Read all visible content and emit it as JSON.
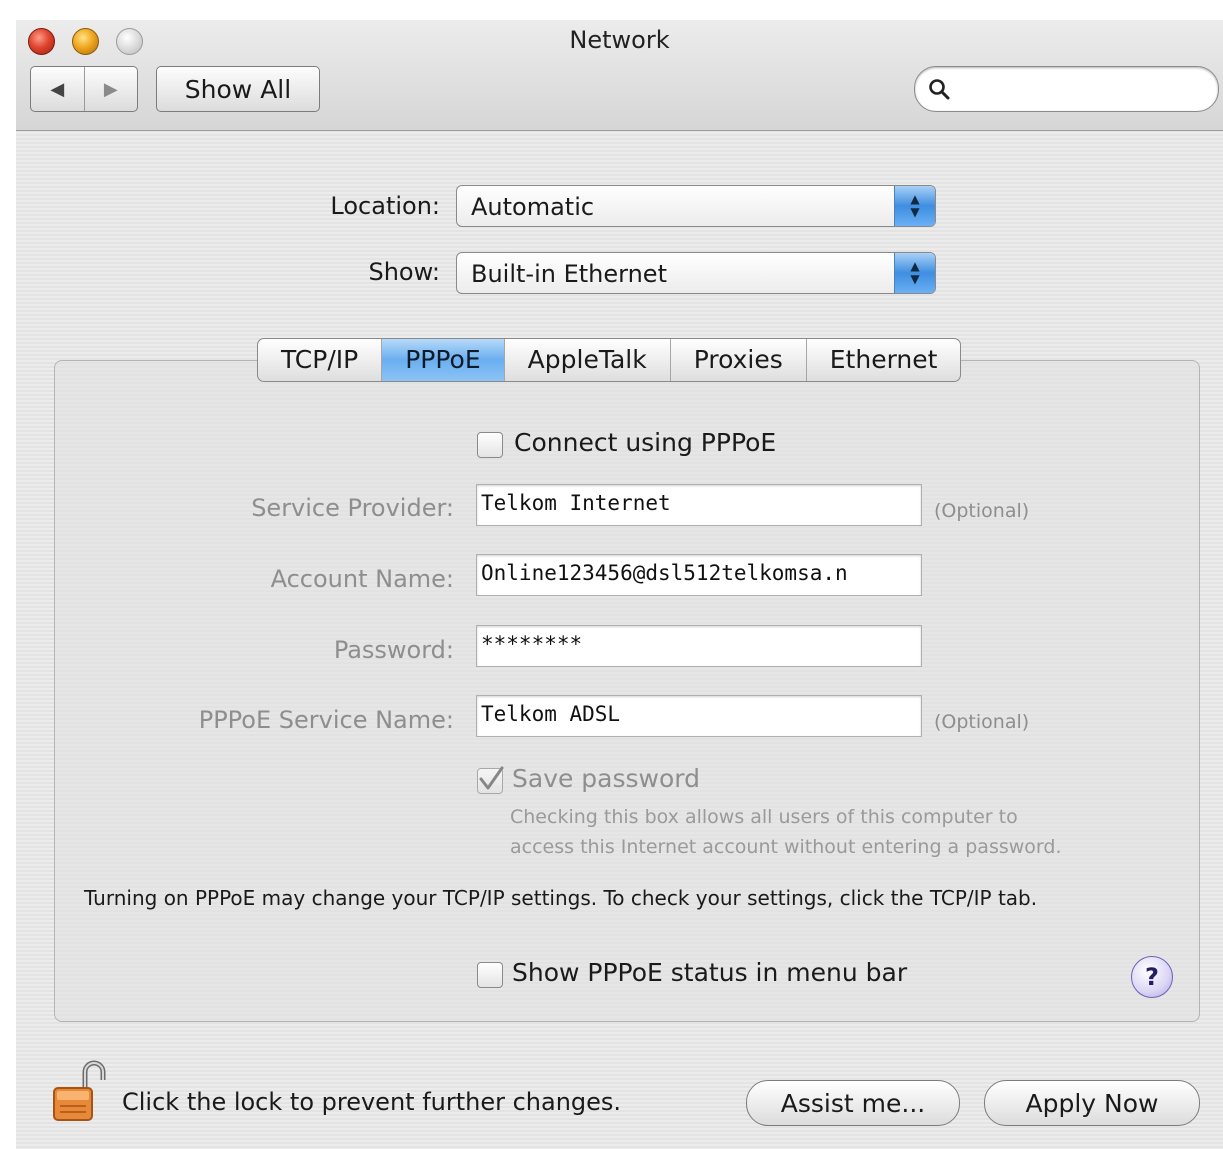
{
  "window": {
    "title": "Network"
  },
  "toolbar": {
    "back_glyph": "◀",
    "forward_glyph": "▶",
    "show_all_label": "Show All",
    "search_value": ""
  },
  "location": {
    "label": "Location:",
    "value": "Automatic"
  },
  "show": {
    "label": "Show:",
    "value": "Built-in Ethernet"
  },
  "tabs": [
    {
      "label": "TCP/IP",
      "selected": false
    },
    {
      "label": "PPPoE",
      "selected": true
    },
    {
      "label": "AppleTalk",
      "selected": false
    },
    {
      "label": "Proxies",
      "selected": false
    },
    {
      "label": "Ethernet",
      "selected": false
    }
  ],
  "pppoe": {
    "connect_label": "Connect using PPPoE",
    "connect_checked": false,
    "service_provider": {
      "label": "Service Provider:",
      "value": "Telkom Internet",
      "note": "(Optional)"
    },
    "account_name": {
      "label": "Account Name:",
      "value": "Online123456@dsl512telkomsa.n"
    },
    "password": {
      "label": "Password:",
      "value": "********"
    },
    "service_name": {
      "label": "PPPoE Service Name:",
      "value": "Telkom ADSL",
      "note": "(Optional)"
    },
    "save_password": {
      "label": "Save password",
      "checked": true,
      "help_line1": "Checking this box allows all users of this computer to",
      "help_line2": "access this Internet account without entering a password."
    },
    "note": "Turning on PPPoE may change your TCP/IP settings. To check your settings, click the TCP/IP tab.",
    "status_menu_label": "Show PPPoE status in menu bar",
    "status_menu_checked": false,
    "help_glyph": "?"
  },
  "footer": {
    "lock_text": "Click the lock to prevent further changes.",
    "assist_label": "Assist me...",
    "apply_label": "Apply Now"
  },
  "colors": {
    "accent": "#5ea6ec",
    "disabled_text": "#8e8e8e"
  }
}
